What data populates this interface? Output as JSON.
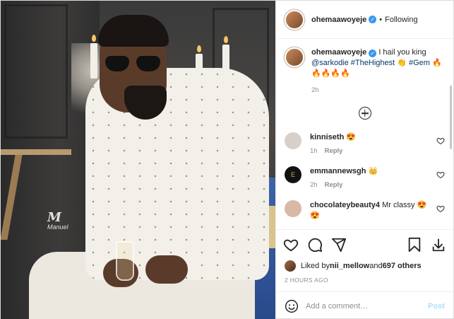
{
  "photo": {
    "watermark_logo": "M",
    "watermark_name": "Manuel"
  },
  "header": {
    "username": "ohemaawoyeje",
    "verified_glyph": "✓",
    "separator": "•",
    "follow_status": "Following"
  },
  "caption": {
    "username": "ohemaawoyeje",
    "text_before": " I hail you king ",
    "mention": "@sarkodie",
    "hashtag1": " #TheHighest",
    "emoji1": " 👏 ",
    "hashtag2": "#Gem",
    "emoji2": " 🔥",
    "emoji_line": "🔥🔥🔥🔥",
    "time": "2h"
  },
  "comments": [
    {
      "username": "kinniseth",
      "text": " 😍",
      "time": "1h",
      "reply": "Reply",
      "avatar_color": "#d8d0c8"
    },
    {
      "username": "emmannewsgh",
      "text": " 👑",
      "time": "2h",
      "reply": "Reply",
      "avatar_color": "#111111"
    },
    {
      "username": "chocolateybeauty4",
      "text": " Mr classy 😍",
      "text2": "😍",
      "time": "",
      "reply": "",
      "avatar_color": "#d9b8a6"
    }
  ],
  "actions": {
    "icons": [
      "heart-icon",
      "comment-icon",
      "share-icon",
      "bookmark-icon",
      "download-icon"
    ]
  },
  "likes": {
    "prefix": "Liked by ",
    "user": "nii_mellow",
    "middle": " and ",
    "others": "697 others"
  },
  "timestamp": "2 HOURS AGO",
  "add_comment": {
    "placeholder": "Add a comment…",
    "post_label": "Post"
  },
  "colors": {
    "link": "#00376b",
    "verified": "#3897f0",
    "post_disabled": "#b2dffc"
  }
}
